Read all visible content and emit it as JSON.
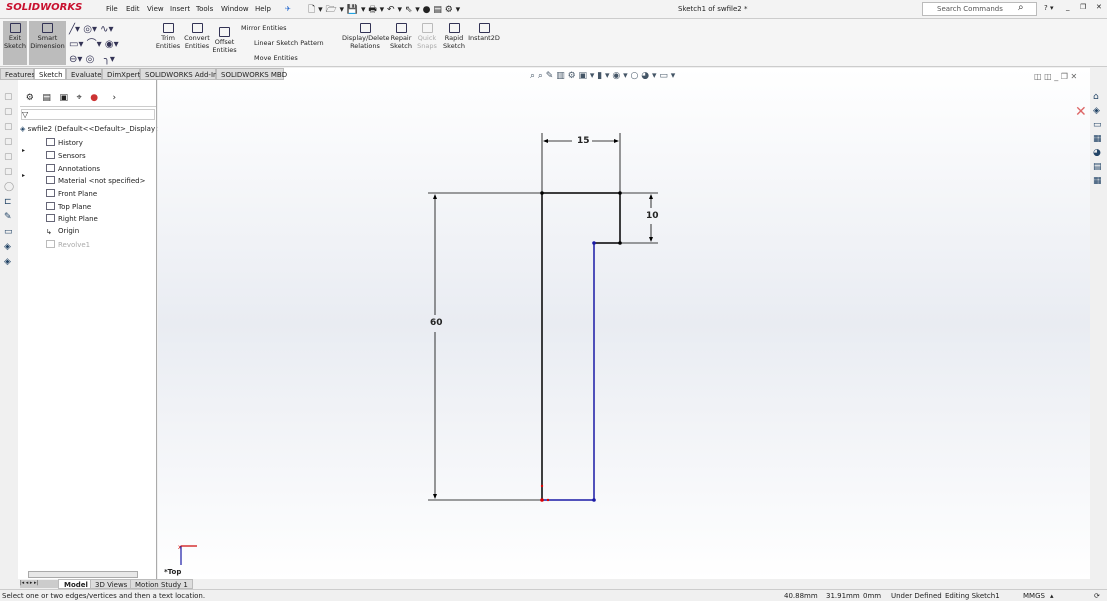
{
  "app": {
    "logo": "SOLIDWORKS",
    "document_title": "Sketch1 of swfile2 *",
    "search_placeholder": "Search Commands"
  },
  "menu": [
    "File",
    "Edit",
    "View",
    "Insert",
    "Tools",
    "Window",
    "Help"
  ],
  "ribbon": {
    "exit_sketch": "Exit Sketch",
    "smart_dimension": "Smart Dimension",
    "trim": "Trim Entities",
    "convert": "Convert Entities",
    "offset": "Offset Entities",
    "mirror": "Mirror Entities",
    "linear_pattern": "Linear Sketch Pattern",
    "move": "Move Entities",
    "relations": "Display/Delete Relations",
    "repair": "Repair Sketch",
    "quick_snaps": "Quick Snaps",
    "rapid": "Rapid Sketch",
    "instant2d": "Instant2D"
  },
  "tabs": [
    "Features",
    "Sketch",
    "Evaluate",
    "DimXpert",
    "SOLIDWORKS Add-Ins",
    "SOLIDWORKS MBD"
  ],
  "tree": {
    "root": "swfile2  (Default<<Default>_Display State",
    "items": [
      "History",
      "Sensors",
      "Annotations",
      "Material <not specified>",
      "Front Plane",
      "Top Plane",
      "Right Plane",
      "Origin",
      "Revolve1"
    ]
  },
  "sketch": {
    "dim_width": "15",
    "dim_step": "10",
    "dim_height": "60",
    "view_label": "*Top"
  },
  "bottom_tabs": [
    "Model",
    "3D Views",
    "Motion Study 1"
  ],
  "status": {
    "message": "Select one or two edges/vertices and then a text location.",
    "x": "40.88mm",
    "y": "31.91mm",
    "z": "0mm",
    "state": "Under Defined",
    "editing": "Editing Sketch1",
    "units": "MMGS"
  },
  "colors": {
    "brand": "#c8102e",
    "sketch_defined": "#000000",
    "sketch_underdefined": "#1a1aa6"
  }
}
